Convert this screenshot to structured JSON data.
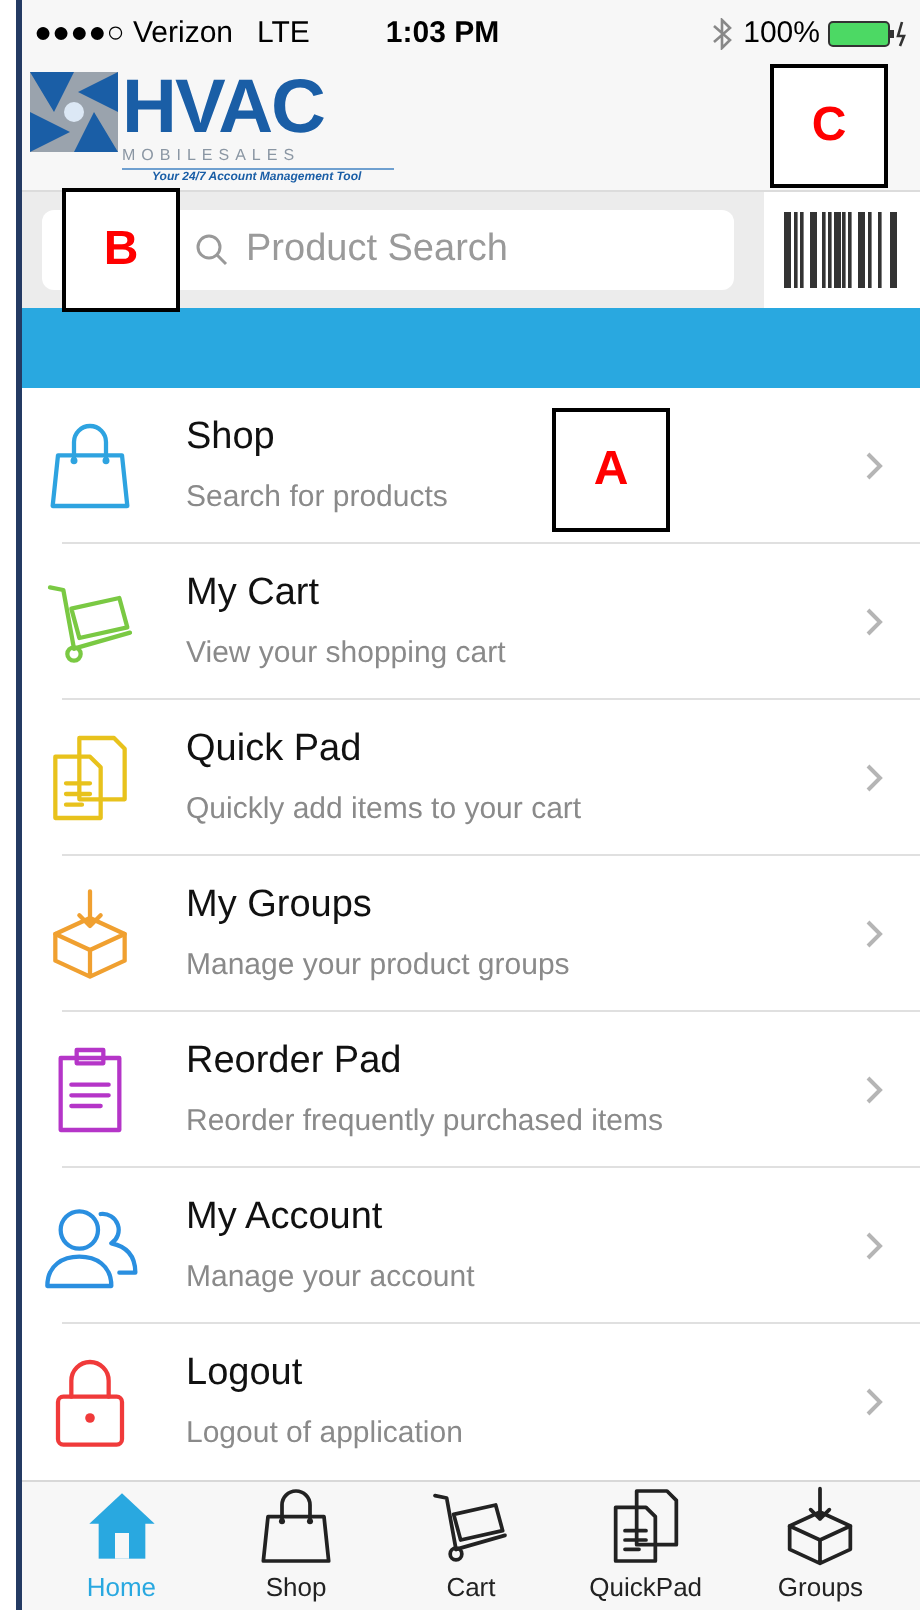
{
  "status_bar": {
    "carrier": "●●●●○ Verizon",
    "network": "LTE",
    "time": "1:03 PM",
    "battery": "100%"
  },
  "header": {
    "logo_title": "HVAC",
    "logo_subtitle": "MOBILESALES",
    "logo_tagline": "Your 24/7 Account Management Tool"
  },
  "search": {
    "placeholder": "Product Search"
  },
  "menu": [
    {
      "kind": "shop",
      "title": "Shop",
      "subtitle": "Search for products",
      "color": "#2ea3e0"
    },
    {
      "kind": "cart",
      "title": "My Cart",
      "subtitle": "View your shopping cart",
      "color": "#7ac943"
    },
    {
      "kind": "quickpad",
      "title": "Quick Pad",
      "subtitle": "Quickly add items to your cart",
      "color": "#e8c21c"
    },
    {
      "kind": "groups",
      "title": "My Groups",
      "subtitle": "Manage your product groups",
      "color": "#f0a030"
    },
    {
      "kind": "reorder",
      "title": "Reorder Pad",
      "subtitle": "Reorder frequently purchased items",
      "color": "#b535c8"
    },
    {
      "kind": "account",
      "title": "My Account",
      "subtitle": "Manage your account",
      "color": "#2a8fe0"
    },
    {
      "kind": "logout",
      "title": "Logout",
      "subtitle": "Logout of application",
      "color": "#f03a3a"
    }
  ],
  "tab_bar": [
    {
      "kind": "home",
      "label": "Home",
      "selected": true
    },
    {
      "kind": "shop",
      "label": "Shop",
      "selected": false
    },
    {
      "kind": "cart",
      "label": "Cart",
      "selected": false
    },
    {
      "kind": "quickpad",
      "label": "QuickPad",
      "selected": false
    },
    {
      "kind": "groups",
      "label": "Groups",
      "selected": false
    }
  ],
  "callouts": [
    {
      "label": "C"
    },
    {
      "label": "B"
    },
    {
      "label": "A"
    }
  ]
}
